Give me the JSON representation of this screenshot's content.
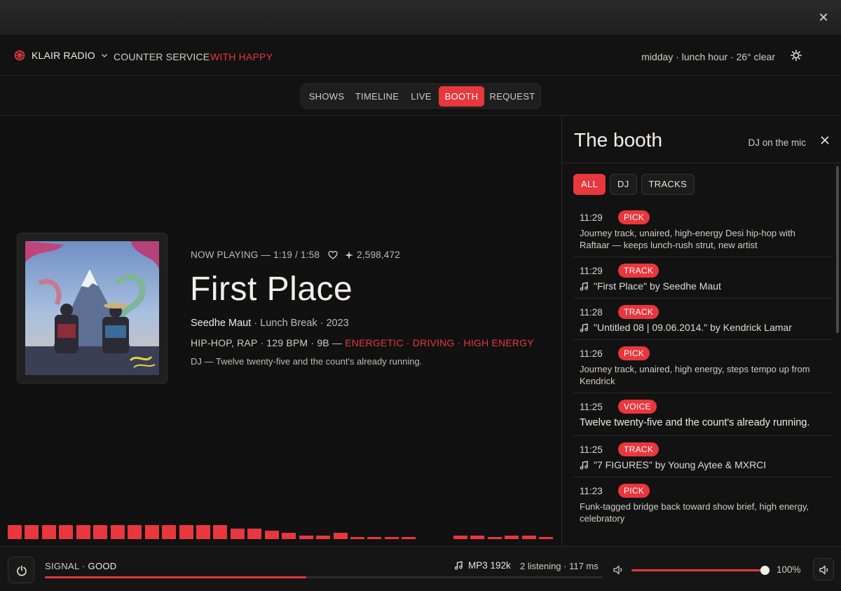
{
  "window": {
    "close_glyph": "✕"
  },
  "nav": {
    "brand": "KLAIR RADIO",
    "show": "COUNTER SERVICE",
    "host": "WITH HAPPY",
    "weather": "midday · lunch hour · 26° clear"
  },
  "tabs": [
    {
      "label": "SHOWS",
      "active": false
    },
    {
      "label": "TIMELINE",
      "active": false
    },
    {
      "label": "LIVE",
      "active": false
    },
    {
      "label": "BOOTH",
      "active": true
    },
    {
      "label": "REQUEST",
      "active": false
    }
  ],
  "now_playing": {
    "label": "NOW PLAYING — 1:19 / 1:58",
    "plays": "2,598,472",
    "title": "First Place",
    "artist": "Seedhe Maut",
    "album_year": " · Lunch Break · 2023",
    "genre": "HIP-HOP, RAP · 129 BPM · 9B — ",
    "mood": "ENERGETIC · DRIVING · HIGH ENERGY",
    "dj_note": "DJ — Twelve twenty-five and the count's already running."
  },
  "visualizer": {
    "levels": [
      0.22,
      0.22,
      0.22,
      0.22,
      0.22,
      0.22,
      0.22,
      0.22,
      0.22,
      0.22,
      0.22,
      0.22,
      0.22,
      0.17,
      0.17,
      0.13,
      0.1,
      0.06,
      0.06,
      0.1,
      0.03,
      0.03,
      0.03,
      0.03,
      0,
      0,
      0.05,
      0.05,
      0.03,
      0.05,
      0.05,
      0.03
    ],
    "color": "#e8373d"
  },
  "booth": {
    "title": "The booth",
    "subtitle": "DJ on the mic",
    "filters": [
      {
        "label": "ALL",
        "active": true
      },
      {
        "label": "DJ",
        "active": false
      },
      {
        "label": "TRACKS",
        "active": false
      }
    ],
    "entries": [
      {
        "time": "11:29",
        "kind": "PICK",
        "text": "Journey track, unaired, high-energy Desi hip-hop with Raftaar — keeps lunch-rush strut, new artist"
      },
      {
        "time": "11:29",
        "kind": "TRACK",
        "text": "\"First Place\" by Seedhe Maut"
      },
      {
        "time": "11:28",
        "kind": "TRACK",
        "text": "\"Untitled 08 | 09.06.2014.\" by Kendrick Lamar"
      },
      {
        "time": "11:26",
        "kind": "PICK",
        "text": "Journey track, unaired, high energy, steps tempo up from Kendrick"
      },
      {
        "time": "11:25",
        "kind": "VOICE",
        "text": "Twelve twenty-five and the count's already running."
      },
      {
        "time": "11:25",
        "kind": "TRACK",
        "text": "\"7 FIGURES\" by Young Aytee & MXRCI"
      },
      {
        "time": "11:23",
        "kind": "PICK",
        "text": "Funk-tagged bridge back toward show brief, high energy, celebratory"
      }
    ]
  },
  "player": {
    "signal_label": "SIGNAL ·",
    "signal_value": "GOOD",
    "progress": 0.469,
    "codec": "MP3 192k",
    "listening": "2 listening · 117 ms",
    "volume": 1.0,
    "volume_label": "100%"
  },
  "colors": {
    "accent": "#e8373d",
    "background": "#111111"
  }
}
